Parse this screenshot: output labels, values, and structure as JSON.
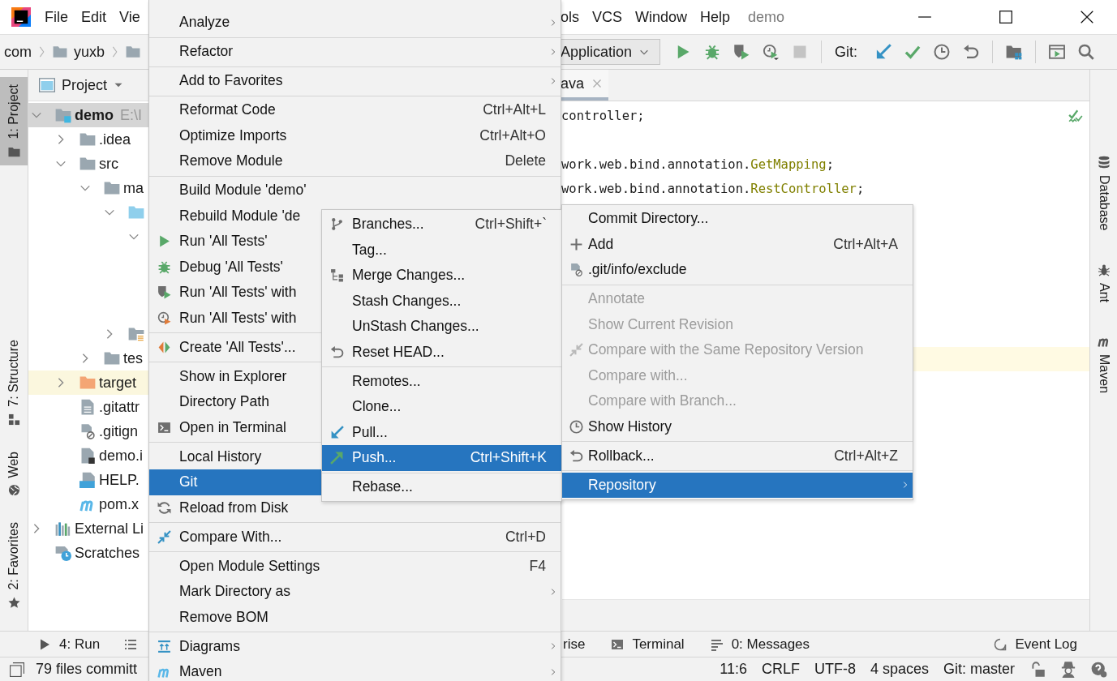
{
  "title_bar": {
    "menus_left": [
      "File",
      "Edit",
      "Vie"
    ],
    "menus_right": [
      "ols",
      "VCS",
      "Window",
      "Help"
    ],
    "project": "demo"
  },
  "nav_bar": {
    "breadcrumbs": [
      {
        "kind": "package",
        "label": "com"
      },
      {
        "kind": "folder",
        "label": "yuxb"
      },
      {
        "kind": "folder"
      }
    ],
    "run_config": "Application",
    "git_label": "Git:"
  },
  "left_strip": [
    {
      "label": "1: Project",
      "selected": true
    },
    {
      "label": "7: Structure",
      "selected": false
    },
    {
      "label": "Web",
      "selected": false
    },
    {
      "label": "2: Favorites",
      "selected": false
    }
  ],
  "project_panel": {
    "title": "Project",
    "tree": [
      {
        "kind": "module",
        "label": "demo",
        "path": "E:\\I",
        "expanded": true,
        "selected": true,
        "children": [
          {
            "kind": "folder",
            "label": ".idea",
            "expanded": false,
            "selected": false
          },
          {
            "kind": "folder",
            "label": "src",
            "expanded": true,
            "selected": false,
            "children": [
              {
                "kind": "folder",
                "label": "ma",
                "expanded": true,
                "selected": false,
                "children": [
                  {
                    "kind": "source_folder",
                    "expanded": true,
                    "selected": false,
                    "children": [
                      {
                        "expanded": true,
                        "selected": false
                      }
                    ]
                  },
                  {
                    "kind": "resource_folder",
                    "expanded": false,
                    "selected": false
                  }
                ]
              },
              {
                "kind": "folder",
                "label": "tes",
                "expanded": false,
                "selected": false
              }
            ]
          },
          {
            "kind": "excluded_folder",
            "label": "target",
            "expanded": false,
            "selected": false,
            "highlighted": true
          },
          {
            "kind": "text_file",
            "label": ".gitattr",
            "selected": false
          },
          {
            "kind": "ignore_file",
            "label": ".gitign",
            "selected": false
          },
          {
            "kind": "module_file",
            "label": "demo.i",
            "selected": false
          },
          {
            "kind": "markdown_file",
            "label": "HELP.",
            "selected": false
          },
          {
            "kind": "maven_file",
            "label": "pom.x",
            "selected": false
          }
        ]
      },
      {
        "kind": "libraries",
        "label": "External Li",
        "expanded": false,
        "selected": false
      },
      {
        "kind": "scratches",
        "label": "Scratches",
        "selected": false
      }
    ]
  },
  "editor": {
    "tab": "ava",
    "current_line_highlighted": true,
    "lines": [
      {
        "kind": "code",
        "segments": [
          {
            "kind": "plain",
            "text": "controller;"
          }
        ]
      },
      {
        "kind": "blank"
      },
      {
        "kind": "code",
        "segments": [
          {
            "kind": "plain",
            "text": "work.web.bind.annotation."
          },
          {
            "kind": "annotation",
            "text": "GetMapping"
          },
          {
            "kind": "plain",
            "text": ";"
          }
        ]
      },
      {
        "kind": "code",
        "segments": [
          {
            "kind": "plain",
            "text": "work.web.bind.annotation."
          },
          {
            "kind": "annotation",
            "text": "RestController"
          },
          {
            "kind": "plain",
            "text": ";"
          }
        ]
      }
    ]
  },
  "right_strip": [
    {
      "label": "Database",
      "selected": false
    },
    {
      "label": "Ant",
      "selected": false
    },
    {
      "label": "Maven",
      "selected": false
    }
  ],
  "tool_bar": {
    "left": [
      {
        "kind": "run",
        "label": "4: Run"
      },
      {
        "kind": "list"
      }
    ],
    "middle": [
      {
        "kind": "plain",
        "label": "rise"
      },
      {
        "kind": "terminal",
        "label": "Terminal"
      },
      {
        "kind": "messages",
        "label": "0: Messages"
      }
    ],
    "right": [
      {
        "kind": "event_log",
        "label": "Event Log"
      }
    ]
  },
  "status_bar": {
    "message": "79 files committ",
    "items": [
      "11:6",
      "CRLF",
      "UTF-8",
      "4 spaces",
      "Git: master"
    ]
  },
  "menus": [
    {
      "items": [
        {
          "label": "Analyze",
          "submenu": true,
          "selected": false
        },
        {
          "label": "Refactor",
          "submenu": true,
          "selected": false,
          "separator_before": true
        },
        {
          "label": "Add to Favorites",
          "submenu": true,
          "selected": false,
          "separator_before": true
        },
        {
          "label": "Reformat Code",
          "shortcut": "Ctrl+Alt+L",
          "submenu": false,
          "selected": false,
          "separator_before": true
        },
        {
          "label": "Optimize Imports",
          "shortcut": "Ctrl+Alt+O",
          "submenu": false,
          "selected": false
        },
        {
          "label": "Remove Module",
          "shortcut": "Delete",
          "submenu": false,
          "selected": false
        },
        {
          "label": "Build Module 'demo'",
          "submenu": false,
          "selected": false,
          "separator_before": true
        },
        {
          "label": "Rebuild Module 'de",
          "submenu": false,
          "selected": false
        },
        {
          "label": "Run 'All Tests'",
          "submenu": false,
          "selected": false
        },
        {
          "label": "Debug 'All Tests'",
          "submenu": false,
          "selected": false
        },
        {
          "label": "Run 'All Tests' with",
          "submenu": false,
          "selected": false
        },
        {
          "label": "Run 'All Tests' with",
          "submenu": false,
          "selected": false
        },
        {
          "label": "Create 'All Tests'...",
          "submenu": false,
          "selected": false,
          "separator_before": true
        },
        {
          "label": "Show in Explorer",
          "submenu": false,
          "selected": false,
          "separator_before": true
        },
        {
          "label": "Directory Path",
          "submenu": false,
          "selected": false
        },
        {
          "label": "Open in Terminal",
          "submenu": false,
          "selected": false
        },
        {
          "label": "Local History",
          "submenu": false,
          "selected": false,
          "separator_before": true
        },
        {
          "label": "Git",
          "submenu": false,
          "selected": true
        },
        {
          "label": "Reload from Disk",
          "submenu": false,
          "selected": false
        },
        {
          "label": "Compare With...",
          "shortcut": "Ctrl+D",
          "submenu": false,
          "selected": false,
          "separator_before": true
        },
        {
          "label": "Open Module Settings",
          "shortcut": "F4",
          "submenu": false,
          "selected": false,
          "separator_before": true
        },
        {
          "label": "Mark Directory as",
          "submenu": true,
          "selected": false
        },
        {
          "label": "Remove BOM",
          "submenu": false,
          "selected": false
        },
        {
          "label": "Diagrams",
          "submenu": true,
          "selected": false,
          "separator_before": true
        },
        {
          "label": "Maven",
          "submenu": true,
          "selected": false
        }
      ]
    },
    {
      "items": [
        {
          "label": "Branches...",
          "shortcut": "Ctrl+Shift+`",
          "submenu": false,
          "selected": false
        },
        {
          "label": "Tag...",
          "submenu": false,
          "selected": false
        },
        {
          "label": "Merge Changes...",
          "submenu": false,
          "selected": false
        },
        {
          "label": "Stash Changes...",
          "submenu": false,
          "selected": false
        },
        {
          "label": "UnStash Changes...",
          "submenu": false,
          "selected": false
        },
        {
          "label": "Reset HEAD...",
          "submenu": false,
          "selected": false
        },
        {
          "label": "Remotes...",
          "submenu": false,
          "selected": false,
          "separator_before": true
        },
        {
          "label": "Clone...",
          "submenu": false,
          "selected": false
        },
        {
          "label": "Pull...",
          "submenu": false,
          "selected": false
        },
        {
          "label": "Push...",
          "shortcut": "Ctrl+Shift+K",
          "submenu": false,
          "selected": true
        },
        {
          "label": "Rebase...",
          "submenu": false,
          "selected": false,
          "separator_before": true
        }
      ]
    },
    {
      "items": [
        {
          "label": "Commit Directory...",
          "submenu": false,
          "selected": false,
          "disabled": false
        },
        {
          "label": "Add",
          "shortcut": "Ctrl+Alt+A",
          "submenu": false,
          "selected": false,
          "disabled": false
        },
        {
          "label": ".git/info/exclude",
          "submenu": false,
          "selected": false,
          "disabled": false
        },
        {
          "label": "Annotate",
          "submenu": false,
          "selected": false,
          "disabled": true,
          "separator_before": true
        },
        {
          "label": "Show Current Revision",
          "submenu": false,
          "selected": false,
          "disabled": true
        },
        {
          "label": "Compare with the Same Repository Version",
          "submenu": false,
          "selected": false,
          "disabled": true
        },
        {
          "label": "Compare with...",
          "submenu": false,
          "selected": false,
          "disabled": true
        },
        {
          "label": "Compare with Branch...",
          "submenu": false,
          "selected": false,
          "disabled": true
        },
        {
          "label": "Show History",
          "submenu": false,
          "selected": false,
          "disabled": false
        },
        {
          "label": "Rollback...",
          "shortcut": "Ctrl+Alt+Z",
          "submenu": false,
          "selected": false,
          "disabled": false,
          "separator_before": true
        },
        {
          "label": "Repository",
          "submenu": true,
          "selected": true,
          "disabled": false,
          "separator_before": true
        }
      ]
    }
  ]
}
